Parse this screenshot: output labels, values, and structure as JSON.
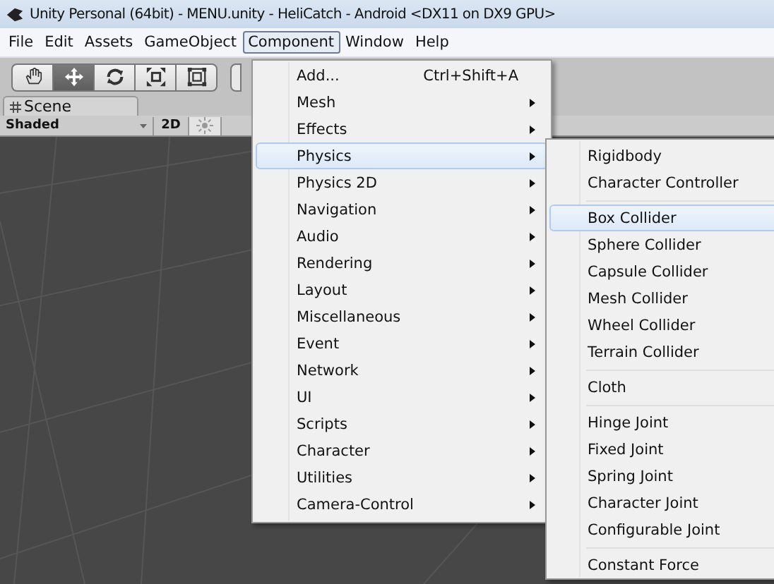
{
  "window": {
    "title": "Unity Personal (64bit) - MENU.unity - HeliCatch - Android <DX11 on DX9 GPU>"
  },
  "menubar": [
    {
      "label": "File",
      "selected": false
    },
    {
      "label": "Edit",
      "selected": false
    },
    {
      "label": "Assets",
      "selected": false
    },
    {
      "label": "GameObject",
      "selected": false
    },
    {
      "label": "Component",
      "selected": true
    },
    {
      "label": "Window",
      "selected": false
    },
    {
      "label": "Help",
      "selected": false
    }
  ],
  "tools": [
    {
      "kind": "hand",
      "selected": false
    },
    {
      "kind": "move",
      "selected": true
    },
    {
      "kind": "rotate",
      "selected": false
    },
    {
      "kind": "scale",
      "selected": false
    },
    {
      "kind": "rect",
      "selected": false
    }
  ],
  "scene_tab": {
    "label": "Scene"
  },
  "scene_toolbar": {
    "shading": "Shaded",
    "mode_2d": "2D"
  },
  "menu": [
    {
      "kind": "item",
      "label": "Add...",
      "shortcut": "Ctrl+Shift+A",
      "selected": false
    },
    {
      "kind": "submenu",
      "label": "Mesh",
      "selected": false
    },
    {
      "kind": "submenu",
      "label": "Effects",
      "selected": false
    },
    {
      "kind": "submenu",
      "label": "Physics",
      "selected": true
    },
    {
      "kind": "submenu",
      "label": "Physics 2D",
      "selected": false
    },
    {
      "kind": "submenu",
      "label": "Navigation",
      "selected": false
    },
    {
      "kind": "submenu",
      "label": "Audio",
      "selected": false
    },
    {
      "kind": "submenu",
      "label": "Rendering",
      "selected": false
    },
    {
      "kind": "submenu",
      "label": "Layout",
      "selected": false
    },
    {
      "kind": "submenu",
      "label": "Miscellaneous",
      "selected": false
    },
    {
      "kind": "submenu",
      "label": "Event",
      "selected": false
    },
    {
      "kind": "submenu",
      "label": "Network",
      "selected": false
    },
    {
      "kind": "submenu",
      "label": "UI",
      "selected": false
    },
    {
      "kind": "submenu",
      "label": "Scripts",
      "selected": false
    },
    {
      "kind": "submenu",
      "label": "Character",
      "selected": false
    },
    {
      "kind": "submenu",
      "label": "Utilities",
      "selected": false
    },
    {
      "kind": "submenu",
      "label": "Camera-Control",
      "selected": false
    }
  ],
  "submenu": [
    {
      "kind": "item",
      "label": "Rigidbody",
      "selected": false
    },
    {
      "kind": "item",
      "label": "Character Controller",
      "selected": false
    },
    {
      "kind": "separator"
    },
    {
      "kind": "item",
      "label": "Box Collider",
      "selected": true
    },
    {
      "kind": "item",
      "label": "Sphere Collider",
      "selected": false
    },
    {
      "kind": "item",
      "label": "Capsule Collider",
      "selected": false
    },
    {
      "kind": "item",
      "label": "Mesh Collider",
      "selected": false
    },
    {
      "kind": "item",
      "label": "Wheel Collider",
      "selected": false
    },
    {
      "kind": "item",
      "label": "Terrain Collider",
      "selected": false
    },
    {
      "kind": "separator"
    },
    {
      "kind": "item",
      "label": "Cloth",
      "selected": false
    },
    {
      "kind": "separator"
    },
    {
      "kind": "item",
      "label": "Hinge Joint",
      "selected": false
    },
    {
      "kind": "item",
      "label": "Fixed Joint",
      "selected": false
    },
    {
      "kind": "item",
      "label": "Spring Joint",
      "selected": false
    },
    {
      "kind": "item",
      "label": "Character Joint",
      "selected": false
    },
    {
      "kind": "item",
      "label": "Configurable Joint",
      "selected": false
    },
    {
      "kind": "separator"
    },
    {
      "kind": "item",
      "label": "Constant Force",
      "selected": false
    }
  ]
}
